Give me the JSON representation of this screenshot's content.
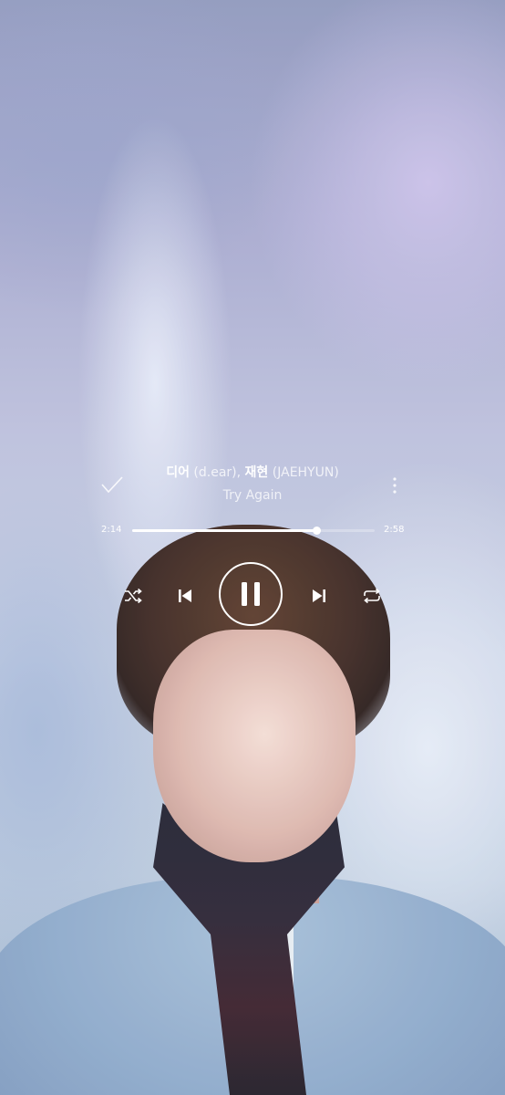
{
  "player": {
    "artist_primary": "디어",
    "artist_primary_en": "(d.ear)",
    "artist_separator": ",",
    "artist_secondary": "재현",
    "artist_secondary_en": "(JAEHYUN)",
    "song_title": "Try Again",
    "time_elapsed": "2:14",
    "time_total": "2:58",
    "progress_fraction": 0.76,
    "is_playing": true
  },
  "icons": {
    "like": "check-icon",
    "more": "more-vertical-icon",
    "shuffle": "shuffle-icon",
    "previous": "skip-previous-icon",
    "pause": "pause-icon",
    "next": "skip-next-icon",
    "repeat": "repeat-icon"
  },
  "colors": {
    "text": "#ffffff",
    "progress_fill": "#ffffff"
  }
}
